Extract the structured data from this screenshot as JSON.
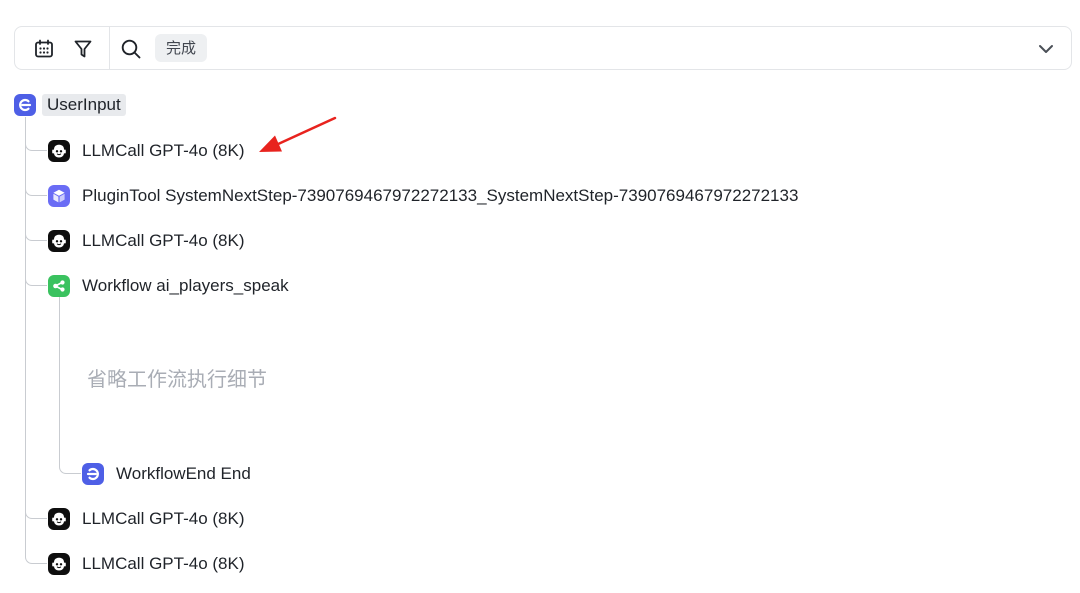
{
  "toolbar": {
    "icons": [
      "calendar-icon",
      "filter-icon",
      "search-icon",
      "chevron-down-icon"
    ],
    "status_tag": "完成"
  },
  "tree": {
    "root": {
      "label": "UserInput",
      "icon": "user-input-icon"
    },
    "nodes": [
      {
        "label": "LLMCall GPT-4o (8K)",
        "icon": "llm-robot-icon"
      },
      {
        "label": "PluginTool SystemNextStep-7390769467972272133_SystemNextStep-7390769467972272133",
        "icon": "plugin-cube-icon"
      },
      {
        "label": "LLMCall GPT-4o (8K)",
        "icon": "llm-robot-icon"
      },
      {
        "label": "Workflow ai_players_speak",
        "icon": "workflow-icon"
      },
      {
        "label": "WorkflowEnd End",
        "icon": "workflow-end-icon"
      },
      {
        "label": "LLMCall GPT-4o (8K)",
        "icon": "llm-robot-icon"
      },
      {
        "label": "LLMCall GPT-4o (8K)",
        "icon": "llm-robot-icon"
      }
    ],
    "omitted_note": "省略工作流执行细节"
  },
  "colors": {
    "user_input_icon": "#4e5fe6",
    "plugin_icon": "#6a6cf5",
    "workflow_icon": "#3ac25f",
    "llm_icon": "#0e0e0e",
    "annotation_arrow": "#e8231e"
  }
}
